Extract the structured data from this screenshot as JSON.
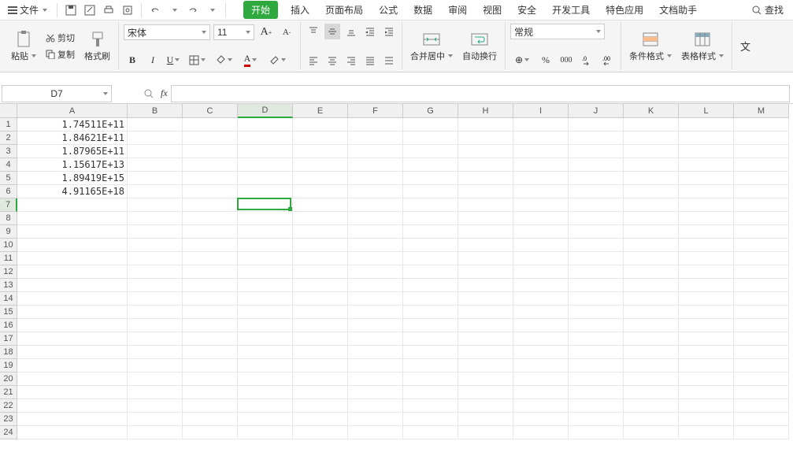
{
  "menubar": {
    "file_label": "文件",
    "search_label": "查找"
  },
  "tabs": {
    "items": [
      "开始",
      "插入",
      "页面布局",
      "公式",
      "数据",
      "审阅",
      "视图",
      "安全",
      "开发工具",
      "特色应用",
      "文档助手"
    ],
    "active_index": 0
  },
  "ribbon": {
    "paste": "粘贴",
    "cut": "剪切",
    "copy": "复制",
    "format_painter": "格式刷",
    "font_name": "宋体",
    "font_size": "11",
    "merge_center": "合并居中",
    "auto_wrap": "自动换行",
    "number_format": "常规",
    "conditional_format": "条件格式",
    "table_style": "表格样式",
    "text_tool": "文"
  },
  "name_box": "D7",
  "columns": [
    {
      "label": "A",
      "width": 140
    },
    {
      "label": "B",
      "width": 70
    },
    {
      "label": "C",
      "width": 70
    },
    {
      "label": "D",
      "width": 70
    },
    {
      "label": "E",
      "width": 70
    },
    {
      "label": "F",
      "width": 70
    },
    {
      "label": "G",
      "width": 70
    },
    {
      "label": "H",
      "width": 70
    },
    {
      "label": "I",
      "width": 70
    },
    {
      "label": "J",
      "width": 70
    },
    {
      "label": "K",
      "width": 70
    },
    {
      "label": "L",
      "width": 70
    },
    {
      "label": "M",
      "width": 70
    }
  ],
  "row_count": 24,
  "selected": {
    "col": 3,
    "row": 6
  },
  "cell_data": {
    "0": {
      "0": "1.74511E+11"
    },
    "1": {
      "0": "1.84621E+11"
    },
    "2": {
      "0": "1.87965E+11"
    },
    "3": {
      "0": "1.15617E+13"
    },
    "4": {
      "0": "1.89419E+15"
    },
    "5": {
      "0": "4.91165E+18"
    }
  }
}
